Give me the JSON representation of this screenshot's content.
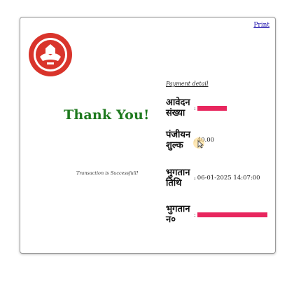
{
  "header": {
    "print_label": "Print"
  },
  "main": {
    "thank_you": "Thank You!",
    "success_message": "Transaction is Successfull!"
  },
  "payment_detail": {
    "title": "Payment detail",
    "rows": [
      {
        "label_line1": "आवेदन",
        "label_line2": "संख्या",
        "value": "",
        "redacted": true
      },
      {
        "label_line1": "पंजीयन",
        "label_line2": "शुल्क",
        "value": "40.00",
        "redacted": false
      },
      {
        "label_line1": "भुगतान",
        "label_line2": "तिथि",
        "value": "06-01-2025 14:07:00",
        "redacted": false
      },
      {
        "label_line1": "भुगतान",
        "label_line2": "न०",
        "value": "",
        "redacted": true
      }
    ],
    "separator": ":"
  },
  "colors": {
    "accent_green": "#1f7a1f",
    "redaction": "#e8265e",
    "logo_red": "#d9342b"
  },
  "icons": {
    "logo": "organization-emblem-icon",
    "cursor": "mouse-cursor-icon"
  }
}
